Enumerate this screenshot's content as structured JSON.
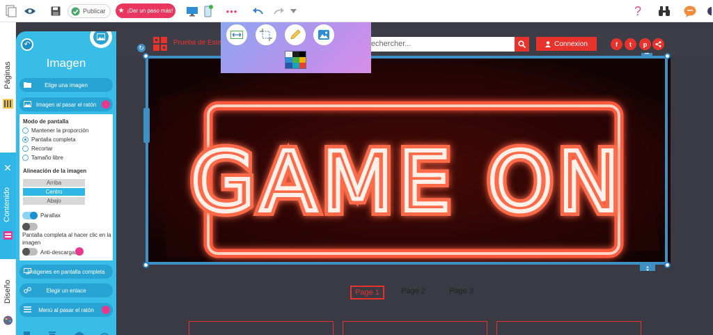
{
  "toolbar": {
    "publish_label": "Publicar",
    "upgrade_label": "¡Dar un paso más!",
    "more_label": "•••"
  },
  "vtabs": {
    "pages": "Páginas",
    "content": "Contenido",
    "design": "Diseño"
  },
  "panel": {
    "title": "Imagen",
    "choose_image": "Elige una imagen",
    "hover_image": "Imagen al pasar el ratón",
    "screen_mode_heading": "Modo de pantalla",
    "screen_modes": [
      "Mantener la proporción",
      "Pantalla completa",
      "Recortar",
      "Tamaño libre"
    ],
    "selected_screen_mode": "Pantalla completa",
    "alignment_heading": "Alineación de la imagen",
    "alignments": [
      "Arriba",
      "Centro",
      "Abajo"
    ],
    "selected_alignment": "Centro",
    "parallax_label": "Parallax",
    "parallax_on": true,
    "fullscreen_click_label": "Pantalla completa al hacer clic en la imagen",
    "fullscreen_click_on": false,
    "antidownload_label": "Anti-descargas",
    "antidownload_on": false,
    "fullscreen_images": "Imágenes en pantalla completa",
    "choose_link": "Elegir un enlace",
    "hover_menu": "Menú al pasar el ratón"
  },
  "site": {
    "brand": "Prueba de Este",
    "search_placeholder": "Rechercher...",
    "connect_label": "Connexion",
    "social_icons": [
      "facebook-icon",
      "twitter-icon",
      "pinterest-icon",
      "share-icon"
    ],
    "hero_text": "GAME ON",
    "pagination": [
      "Page 1",
      "Page 2",
      "Page 3"
    ],
    "active_page": "Page 1"
  },
  "colors": {
    "accent": "#e7332c",
    "panel": "#38bde8",
    "selection": "#3d8fc4",
    "upgrade": "#e8365f"
  }
}
